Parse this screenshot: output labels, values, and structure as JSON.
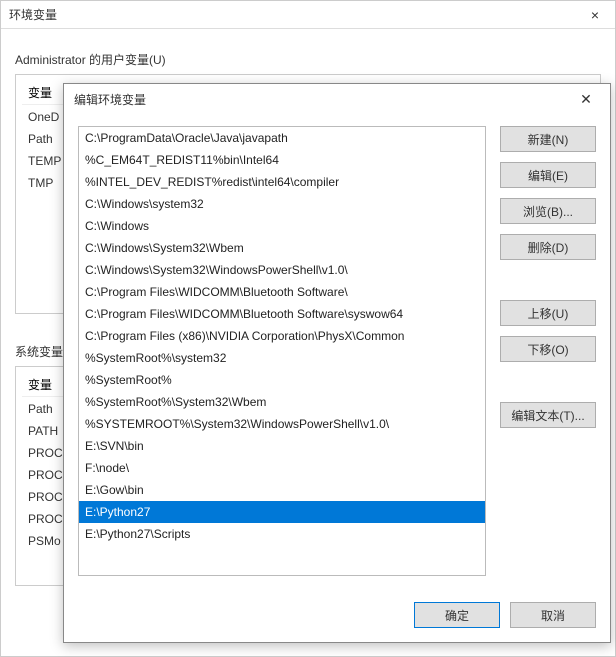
{
  "mainWindow": {
    "title": "环境变量"
  },
  "userSection": {
    "label": "Administrator 的用户变量(U)",
    "colVariable": "变量",
    "vars": [
      "OneD",
      "Path",
      "TEMP",
      "TMP"
    ]
  },
  "systemSection": {
    "label": "系统变量",
    "colVariable": "变量",
    "vars": [
      "Path",
      "PATH",
      "PROC",
      "PROC",
      "PROC",
      "PROC",
      "PSMo"
    ]
  },
  "dialog": {
    "title": "编辑环境变量",
    "pathItems": [
      "C:\\ProgramData\\Oracle\\Java\\javapath",
      "%C_EM64T_REDIST11%bin\\Intel64",
      "%INTEL_DEV_REDIST%redist\\intel64\\compiler",
      "C:\\Windows\\system32",
      "C:\\Windows",
      "C:\\Windows\\System32\\Wbem",
      "C:\\Windows\\System32\\WindowsPowerShell\\v1.0\\",
      "C:\\Program Files\\WIDCOMM\\Bluetooth Software\\",
      "C:\\Program Files\\WIDCOMM\\Bluetooth Software\\syswow64",
      "C:\\Program Files (x86)\\NVIDIA Corporation\\PhysX\\Common",
      "%SystemRoot%\\system32",
      "%SystemRoot%",
      "%SystemRoot%\\System32\\Wbem",
      "%SYSTEMROOT%\\System32\\WindowsPowerShell\\v1.0\\",
      "E:\\SVN\\bin",
      "F:\\node\\",
      "E:\\Gow\\bin",
      "E:\\Python27",
      "E:\\Python27\\Scripts"
    ],
    "selectedIndex": 17,
    "buttons": {
      "new": "新建(N)",
      "edit": "编辑(E)",
      "browse": "浏览(B)...",
      "delete": "删除(D)",
      "moveUp": "上移(U)",
      "moveDown": "下移(O)",
      "editText": "编辑文本(T)..."
    },
    "footer": {
      "ok": "确定",
      "cancel": "取消"
    }
  }
}
